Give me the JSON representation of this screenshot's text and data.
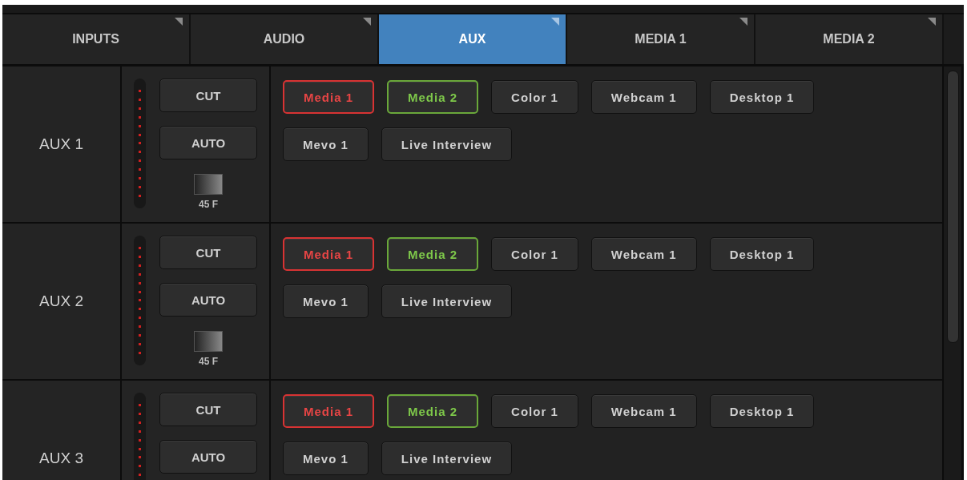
{
  "tabs": [
    {
      "label": "INPUTS",
      "selected": false
    },
    {
      "label": "AUDIO",
      "selected": false
    },
    {
      "label": "AUX",
      "selected": true
    },
    {
      "label": "MEDIA 1",
      "selected": false
    },
    {
      "label": "MEDIA 2",
      "selected": false
    }
  ],
  "aux_rows": [
    {
      "label": "AUX 1",
      "cut": "CUT",
      "auto": "AUTO",
      "duration": "45 F",
      "sources": [
        {
          "label": "Media 1",
          "program": true,
          "preview": false
        },
        {
          "label": "Media 2",
          "program": false,
          "preview": true
        },
        {
          "label": "Color 1",
          "program": false,
          "preview": false
        },
        {
          "label": "Webcam 1",
          "program": false,
          "preview": false
        },
        {
          "label": "Desktop 1",
          "program": false,
          "preview": false
        },
        {
          "label": "Mevo 1",
          "program": false,
          "preview": false
        },
        {
          "label": "Live Interview",
          "program": false,
          "preview": false
        }
      ]
    },
    {
      "label": "AUX 2",
      "cut": "CUT",
      "auto": "AUTO",
      "duration": "45 F",
      "sources": [
        {
          "label": "Media 1",
          "program": true,
          "preview": false
        },
        {
          "label": "Media 2",
          "program": false,
          "preview": true
        },
        {
          "label": "Color 1",
          "program": false,
          "preview": false
        },
        {
          "label": "Webcam 1",
          "program": false,
          "preview": false
        },
        {
          "label": "Desktop 1",
          "program": false,
          "preview": false
        },
        {
          "label": "Mevo 1",
          "program": false,
          "preview": false
        },
        {
          "label": "Live Interview",
          "program": false,
          "preview": false
        }
      ]
    },
    {
      "label": "AUX 3",
      "cut": "CUT",
      "auto": "AUTO",
      "sources": [
        {
          "label": "Media 1",
          "program": true,
          "preview": false
        },
        {
          "label": "Media 2",
          "program": false,
          "preview": true
        },
        {
          "label": "Color 1",
          "program": false,
          "preview": false
        },
        {
          "label": "Webcam 1",
          "program": false,
          "preview": false
        },
        {
          "label": "Desktop 1",
          "program": false,
          "preview": false
        },
        {
          "label": "Mevo 1",
          "program": false,
          "preview": false
        },
        {
          "label": "Live Interview",
          "program": false,
          "preview": false
        }
      ]
    }
  ]
}
